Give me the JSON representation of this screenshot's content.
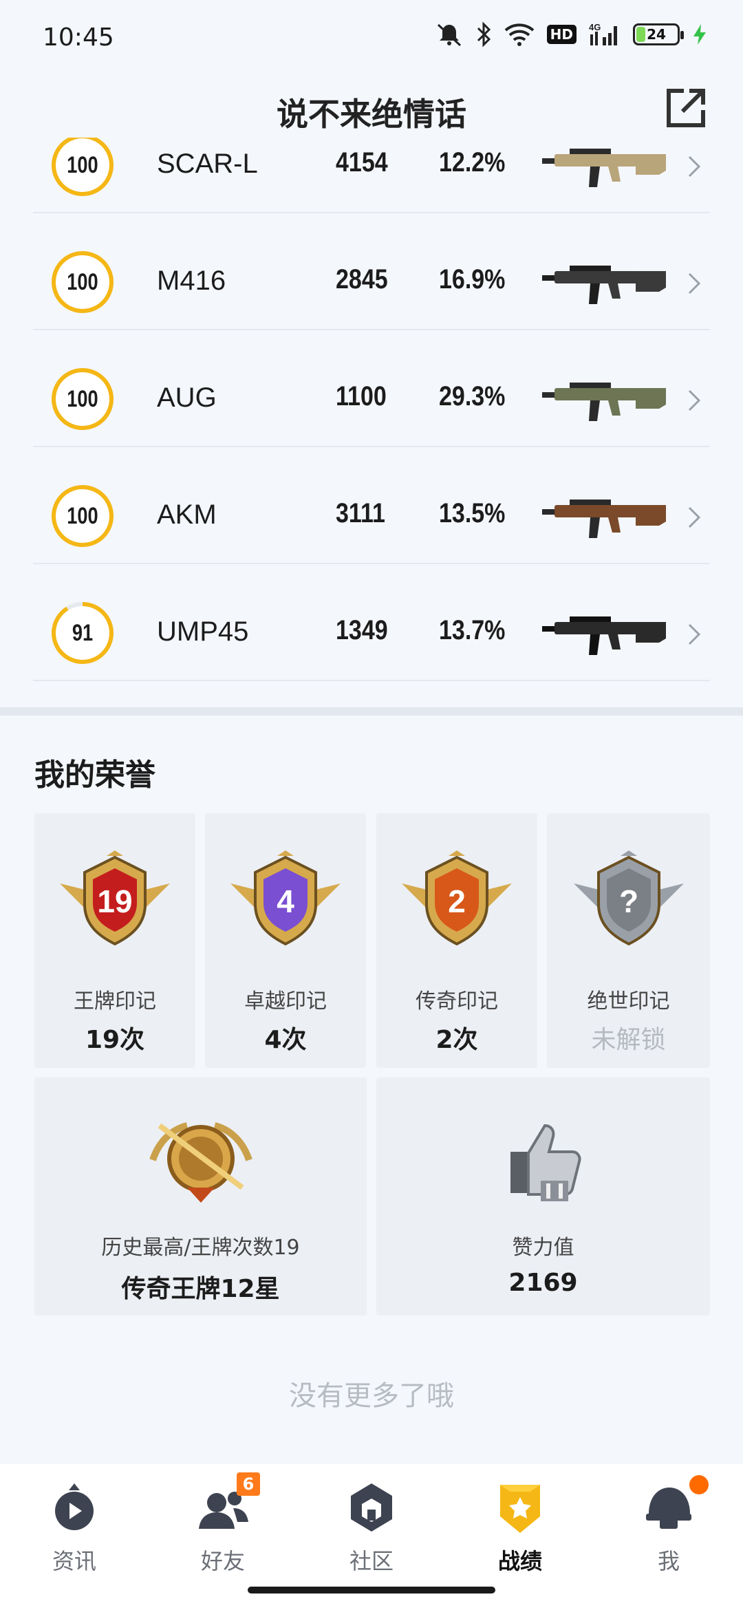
{
  "status": {
    "time": "10:45",
    "network": "4G",
    "hd": "HD",
    "battery": "24",
    "battery_level": 0.24
  },
  "header": {
    "title": "说不来绝情话",
    "share_icon": "share-external-icon"
  },
  "weapons": [
    {
      "rating": "100",
      "progress": 1.0,
      "name": "SCAR-L",
      "kills": "4154",
      "headshot_rate": "12.2%",
      "image": "scar-l-rifle"
    },
    {
      "rating": "100",
      "progress": 1.0,
      "name": "M416",
      "kills": "2845",
      "headshot_rate": "16.9%",
      "image": "m416-rifle"
    },
    {
      "rating": "100",
      "progress": 1.0,
      "name": "AUG",
      "kills": "1100",
      "headshot_rate": "29.3%",
      "image": "aug-rifle"
    },
    {
      "rating": "100",
      "progress": 1.0,
      "name": "AKM",
      "kills": "3111",
      "headshot_rate": "13.5%",
      "image": "akm-rifle"
    },
    {
      "rating": "91",
      "progress": 0.91,
      "name": "UMP45",
      "kills": "1349",
      "headshot_rate": "13.7%",
      "image": "ump45-smg"
    }
  ],
  "honors": {
    "title": "我的荣誉",
    "marks": [
      {
        "badge_number": "19",
        "label": "王牌印记",
        "value": "19次",
        "color": "#c41d1d",
        "locked": false
      },
      {
        "badge_number": "4",
        "label": "卓越印记",
        "value": "4次",
        "color": "#7a4fd1",
        "locked": false
      },
      {
        "badge_number": "2",
        "label": "传奇印记",
        "value": "2次",
        "color": "#d8581a",
        "locked": false
      },
      {
        "badge_number": "?",
        "label": "绝世印记",
        "value": "未解锁",
        "color": "#7b7f86",
        "locked": true
      }
    ],
    "highest": {
      "label": "历史最高/王牌次数19",
      "value": "传奇王牌12星"
    },
    "likes": {
      "label": "赞力值",
      "value": "2169"
    }
  },
  "footer_text": "没有更多了哦",
  "nav": [
    {
      "label": "资讯",
      "icon": "news-play-icon",
      "active": false,
      "badge": ""
    },
    {
      "label": "好友",
      "icon": "friends-icon",
      "active": false,
      "badge": "6"
    },
    {
      "label": "社区",
      "icon": "community-icon",
      "active": false,
      "badge": ""
    },
    {
      "label": "战绩",
      "icon": "record-shield-icon",
      "active": true,
      "badge": ""
    },
    {
      "label": "我",
      "icon": "helmet-icon",
      "active": false,
      "badge": "dot"
    }
  ],
  "colors": {
    "accent": "#f5b715",
    "badge": "#ff7a1a",
    "text_muted": "#b7bbc2"
  }
}
